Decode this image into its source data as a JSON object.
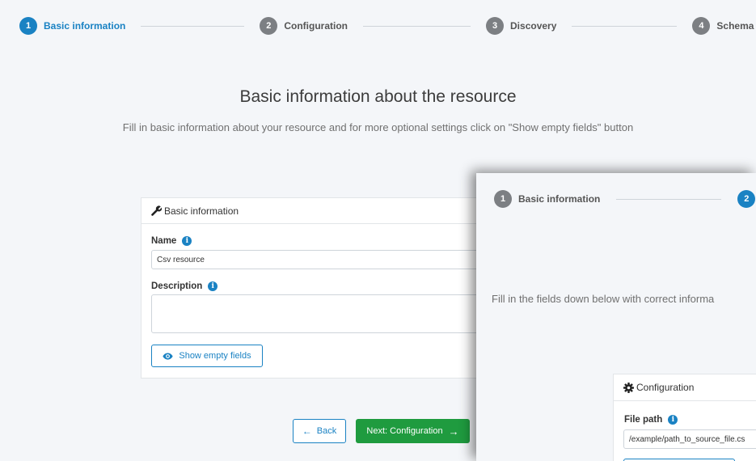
{
  "stepper": {
    "steps": [
      {
        "number": "1",
        "label": "Basic information",
        "state": "active"
      },
      {
        "number": "2",
        "label": "Configuration",
        "state": "inactive"
      },
      {
        "number": "3",
        "label": "Discovery",
        "state": "inactive"
      },
      {
        "number": "4",
        "label": "Schema",
        "state": "inactive"
      }
    ]
  },
  "page": {
    "title": "Basic information about the resource",
    "subtitle": "Fill in basic information about your resource and for more optional settings click on \"Show empty fields\" button"
  },
  "basic_card": {
    "header": "Basic information",
    "name_label": "Name",
    "name_value": "Csv resource",
    "description_label": "Description",
    "description_value": "",
    "show_empty_label": "Show empty fields"
  },
  "footer": {
    "back_label": "Back",
    "next_label": "Next: Configuration"
  },
  "overlay": {
    "stepper": [
      {
        "number": "1",
        "label": "Basic information",
        "state": "inactive"
      },
      {
        "number": "2",
        "label": "",
        "state": "active"
      }
    ],
    "subtitle": "Fill in the fields down below with correct informa",
    "card": {
      "header": "Configuration",
      "file_path_label": "File path",
      "file_path_value": "/example/path_to_source_file.cs"
    }
  },
  "colors": {
    "primary": "#1a82c3",
    "success": "#1f9b3f",
    "inactive": "#7c7f83",
    "background": "#f4f6f9"
  },
  "icons": [
    "wrench-icon",
    "info-icon",
    "eye-icon",
    "arrow-left-icon",
    "arrow-right-icon",
    "gear-icon"
  ]
}
